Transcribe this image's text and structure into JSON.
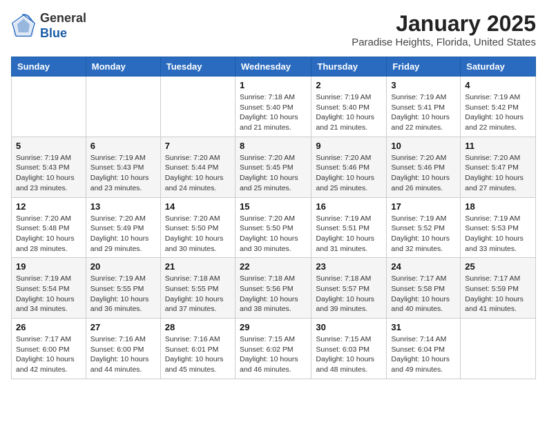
{
  "header": {
    "logo_general": "General",
    "logo_blue": "Blue",
    "title": "January 2025",
    "subtitle": "Paradise Heights, Florida, United States"
  },
  "weekdays": [
    "Sunday",
    "Monday",
    "Tuesday",
    "Wednesday",
    "Thursday",
    "Friday",
    "Saturday"
  ],
  "weeks": [
    [
      {
        "day": "",
        "info": ""
      },
      {
        "day": "",
        "info": ""
      },
      {
        "day": "",
        "info": ""
      },
      {
        "day": "1",
        "info": "Sunrise: 7:18 AM\nSunset: 5:40 PM\nDaylight: 10 hours\nand 21 minutes."
      },
      {
        "day": "2",
        "info": "Sunrise: 7:19 AM\nSunset: 5:40 PM\nDaylight: 10 hours\nand 21 minutes."
      },
      {
        "day": "3",
        "info": "Sunrise: 7:19 AM\nSunset: 5:41 PM\nDaylight: 10 hours\nand 22 minutes."
      },
      {
        "day": "4",
        "info": "Sunrise: 7:19 AM\nSunset: 5:42 PM\nDaylight: 10 hours\nand 22 minutes."
      }
    ],
    [
      {
        "day": "5",
        "info": "Sunrise: 7:19 AM\nSunset: 5:43 PM\nDaylight: 10 hours\nand 23 minutes."
      },
      {
        "day": "6",
        "info": "Sunrise: 7:19 AM\nSunset: 5:43 PM\nDaylight: 10 hours\nand 23 minutes."
      },
      {
        "day": "7",
        "info": "Sunrise: 7:20 AM\nSunset: 5:44 PM\nDaylight: 10 hours\nand 24 minutes."
      },
      {
        "day": "8",
        "info": "Sunrise: 7:20 AM\nSunset: 5:45 PM\nDaylight: 10 hours\nand 25 minutes."
      },
      {
        "day": "9",
        "info": "Sunrise: 7:20 AM\nSunset: 5:46 PM\nDaylight: 10 hours\nand 25 minutes."
      },
      {
        "day": "10",
        "info": "Sunrise: 7:20 AM\nSunset: 5:46 PM\nDaylight: 10 hours\nand 26 minutes."
      },
      {
        "day": "11",
        "info": "Sunrise: 7:20 AM\nSunset: 5:47 PM\nDaylight: 10 hours\nand 27 minutes."
      }
    ],
    [
      {
        "day": "12",
        "info": "Sunrise: 7:20 AM\nSunset: 5:48 PM\nDaylight: 10 hours\nand 28 minutes."
      },
      {
        "day": "13",
        "info": "Sunrise: 7:20 AM\nSunset: 5:49 PM\nDaylight: 10 hours\nand 29 minutes."
      },
      {
        "day": "14",
        "info": "Sunrise: 7:20 AM\nSunset: 5:50 PM\nDaylight: 10 hours\nand 30 minutes."
      },
      {
        "day": "15",
        "info": "Sunrise: 7:20 AM\nSunset: 5:50 PM\nDaylight: 10 hours\nand 30 minutes."
      },
      {
        "day": "16",
        "info": "Sunrise: 7:19 AM\nSunset: 5:51 PM\nDaylight: 10 hours\nand 31 minutes."
      },
      {
        "day": "17",
        "info": "Sunrise: 7:19 AM\nSunset: 5:52 PM\nDaylight: 10 hours\nand 32 minutes."
      },
      {
        "day": "18",
        "info": "Sunrise: 7:19 AM\nSunset: 5:53 PM\nDaylight: 10 hours\nand 33 minutes."
      }
    ],
    [
      {
        "day": "19",
        "info": "Sunrise: 7:19 AM\nSunset: 5:54 PM\nDaylight: 10 hours\nand 34 minutes."
      },
      {
        "day": "20",
        "info": "Sunrise: 7:19 AM\nSunset: 5:55 PM\nDaylight: 10 hours\nand 36 minutes."
      },
      {
        "day": "21",
        "info": "Sunrise: 7:18 AM\nSunset: 5:55 PM\nDaylight: 10 hours\nand 37 minutes."
      },
      {
        "day": "22",
        "info": "Sunrise: 7:18 AM\nSunset: 5:56 PM\nDaylight: 10 hours\nand 38 minutes."
      },
      {
        "day": "23",
        "info": "Sunrise: 7:18 AM\nSunset: 5:57 PM\nDaylight: 10 hours\nand 39 minutes."
      },
      {
        "day": "24",
        "info": "Sunrise: 7:17 AM\nSunset: 5:58 PM\nDaylight: 10 hours\nand 40 minutes."
      },
      {
        "day": "25",
        "info": "Sunrise: 7:17 AM\nSunset: 5:59 PM\nDaylight: 10 hours\nand 41 minutes."
      }
    ],
    [
      {
        "day": "26",
        "info": "Sunrise: 7:17 AM\nSunset: 6:00 PM\nDaylight: 10 hours\nand 42 minutes."
      },
      {
        "day": "27",
        "info": "Sunrise: 7:16 AM\nSunset: 6:00 PM\nDaylight: 10 hours\nand 44 minutes."
      },
      {
        "day": "28",
        "info": "Sunrise: 7:16 AM\nSunset: 6:01 PM\nDaylight: 10 hours\nand 45 minutes."
      },
      {
        "day": "29",
        "info": "Sunrise: 7:15 AM\nSunset: 6:02 PM\nDaylight: 10 hours\nand 46 minutes."
      },
      {
        "day": "30",
        "info": "Sunrise: 7:15 AM\nSunset: 6:03 PM\nDaylight: 10 hours\nand 48 minutes."
      },
      {
        "day": "31",
        "info": "Sunrise: 7:14 AM\nSunset: 6:04 PM\nDaylight: 10 hours\nand 49 minutes."
      },
      {
        "day": "",
        "info": ""
      }
    ]
  ]
}
